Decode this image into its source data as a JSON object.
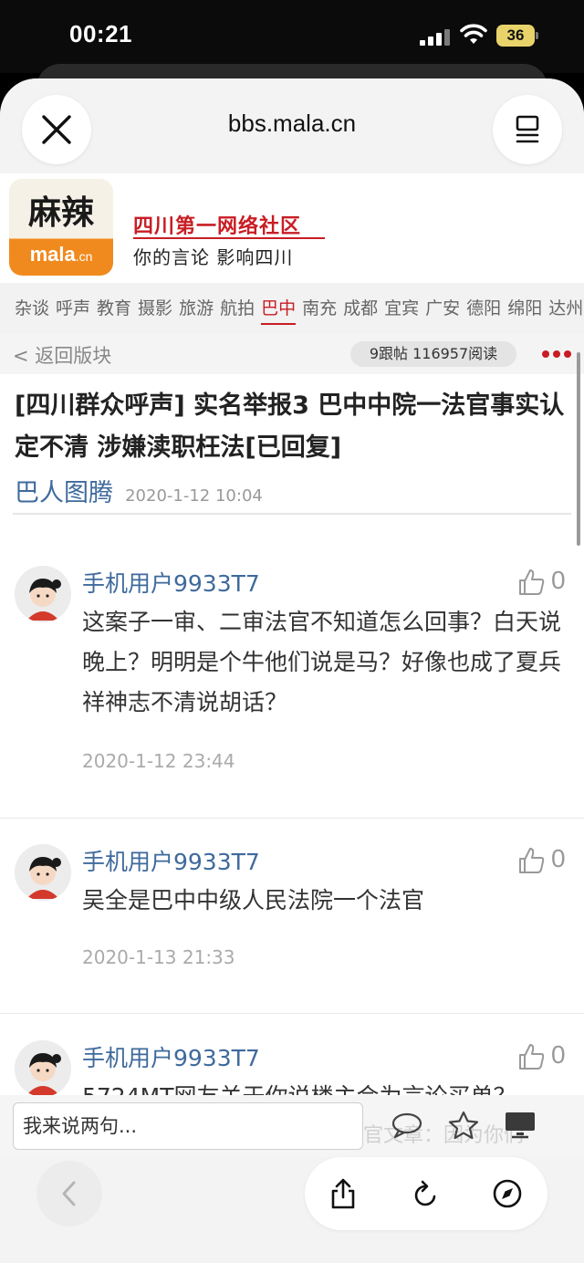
{
  "status_bar": {
    "time": "00:21",
    "battery": "36"
  },
  "browser": {
    "url": "bbs.mala.cn"
  },
  "site": {
    "logo_cn": "麻辣",
    "logo_en": "mala",
    "logo_en_suffix": ".cn",
    "slogan": "四川第一网络社区",
    "tagline": "你的言论 影响四川"
  },
  "categories": [
    "杂谈",
    "呼声",
    "教育",
    "摄影",
    "旅游",
    "航拍",
    "巴中",
    "南充",
    "成都",
    "宜宾",
    "广安",
    "德阳",
    "绵阳",
    "达州"
  ],
  "active_category": "巴中",
  "subbar": {
    "back": "< 返回版块",
    "stats": "9跟帖  116957阅读"
  },
  "post": {
    "title": "[四川群众呼声] 实名举报3 巴中中院一法官事实认定不清 涉嫌渎职枉法[已回复]",
    "author": "巴人图腾",
    "date": "2020-1-12 10:04"
  },
  "replies": [
    {
      "user": "手机用户9933T7",
      "likes": "0",
      "text": "这案子一审、二审法官不知道怎么回事？白天说晚上？明明是个牛他们说是马？好像也成了夏兵祥神志不清说胡话？",
      "time": "2020-1-12 23:44"
    },
    {
      "user": "手机用户9933T7",
      "likes": "0",
      "text": "吴全是巴中中级人民法院一个法官",
      "time": "2020-1-13 21:33"
    },
    {
      "user": "手机用户9933T7",
      "likes": "0",
      "text": "5724MT网友关于你说楼主会为言论买单？",
      "time": ""
    }
  ],
  "comment_bar": {
    "placeholder": "我来说两句...",
    "ghost": "官文章：因为你们"
  },
  "icons": {
    "close": "close-icon",
    "menu": "tabs-icon",
    "comment": "comment-icon",
    "star": "star-icon",
    "desktop": "desktop-icon",
    "back": "chevron-left-icon",
    "share": "share-icon",
    "reload": "reload-icon",
    "compass": "compass-icon",
    "like": "thumbs-up-icon"
  },
  "colors": {
    "brand_red": "#c81d24",
    "link_blue": "#3f6a9c",
    "logo_orange": "#f08a1e"
  }
}
